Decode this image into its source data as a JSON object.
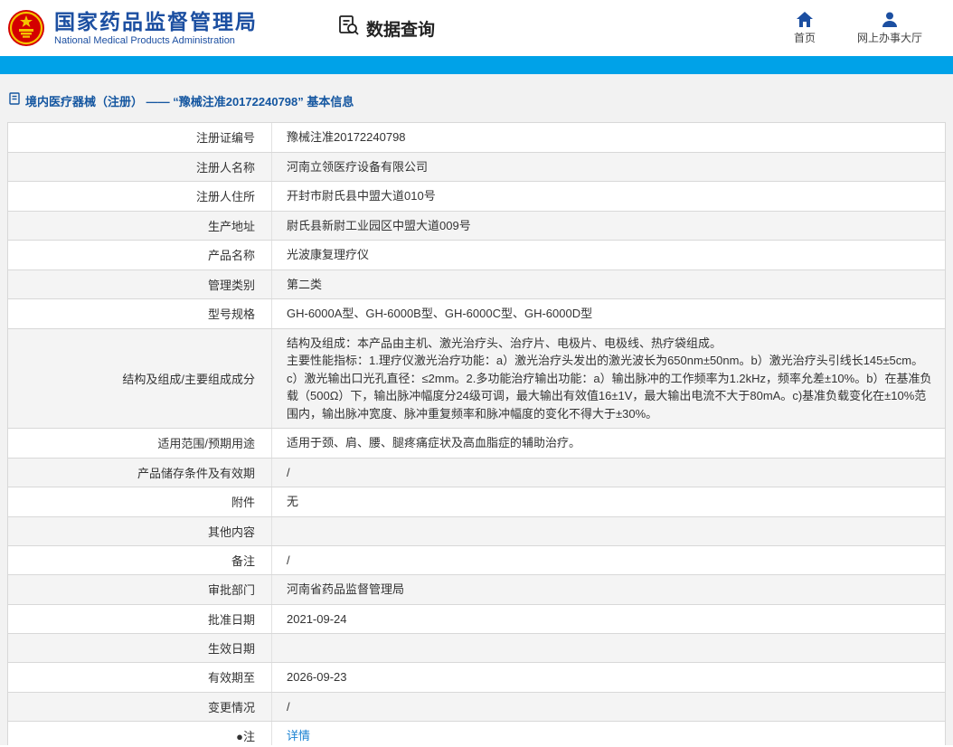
{
  "header": {
    "org_name_cn": "国家药品监督管理局",
    "org_name_en": "National Medical Products Administration",
    "data_query_label": "数据查询",
    "home_label": "首页",
    "service_hall_label": "网上办事大厅"
  },
  "colors": {
    "brand_blue": "#1c4fa1",
    "bar_blue": "#00a2e8",
    "link_blue": "#1b82d2",
    "emblem_red": "#d40000",
    "emblem_gold": "#f5c400"
  },
  "breadcrumb": {
    "text": "境内医疗器械（注册） —— “豫械注准20172240798” 基本信息"
  },
  "table": {
    "rows": [
      {
        "label": "注册证编号",
        "value": "豫械注准20172240798"
      },
      {
        "label": "注册人名称",
        "value": "河南立领医疗设备有限公司"
      },
      {
        "label": "注册人住所",
        "value": "开封市尉氏县中盟大道010号"
      },
      {
        "label": "生产地址",
        "value": "尉氏县新尉工业园区中盟大道009号"
      },
      {
        "label": "产品名称",
        "value": "光波康复理疗仪"
      },
      {
        "label": "管理类别",
        "value": "第二类"
      },
      {
        "label": "型号规格",
        "value": "GH-6000A型、GH-6000B型、GH-6000C型、GH-6000D型"
      },
      {
        "label": "结构及组成/主要组成成分",
        "value": "结构及组成：本产品由主机、激光治疗头、治疗片、电极片、电极线、热疗袋组成。\n主要性能指标：1.理疗仪激光治疗功能：a）激光治疗头发出的激光波长为650nm±50nm。b）激光治疗头引线长145±5cm。c）激光输出口光孔直径：≤2mm。2.多功能治疗输出功能：a）输出脉冲的工作频率为1.2kHz，频率允差±10%。b）在基准负载（500Ω）下，输出脉冲幅度分24级可调，最大输出有效值16±1V，最大输出电流不大于80mA。c)基准负载变化在±10%范围内，输出脉冲宽度、脉冲重复频率和脉冲幅度的变化不得大于±30%。"
      },
      {
        "label": "适用范围/预期用途",
        "value": "适用于颈、肩、腰、腿疼痛症状及高血脂症的辅助治疗。"
      },
      {
        "label": "产品储存条件及有效期",
        "value": "/"
      },
      {
        "label": "附件",
        "value": "无"
      },
      {
        "label": "其他内容",
        "value": ""
      },
      {
        "label": "备注",
        "value": "/"
      },
      {
        "label": "审批部门",
        "value": "河南省药品监督管理局"
      },
      {
        "label": "批准日期",
        "value": "2021-09-24"
      },
      {
        "label": "生效日期",
        "value": ""
      },
      {
        "label": "有效期至",
        "value": "2026-09-23"
      },
      {
        "label": "变更情况",
        "value": "/"
      },
      {
        "label": "●注",
        "value": "详情",
        "link": true
      }
    ]
  }
}
